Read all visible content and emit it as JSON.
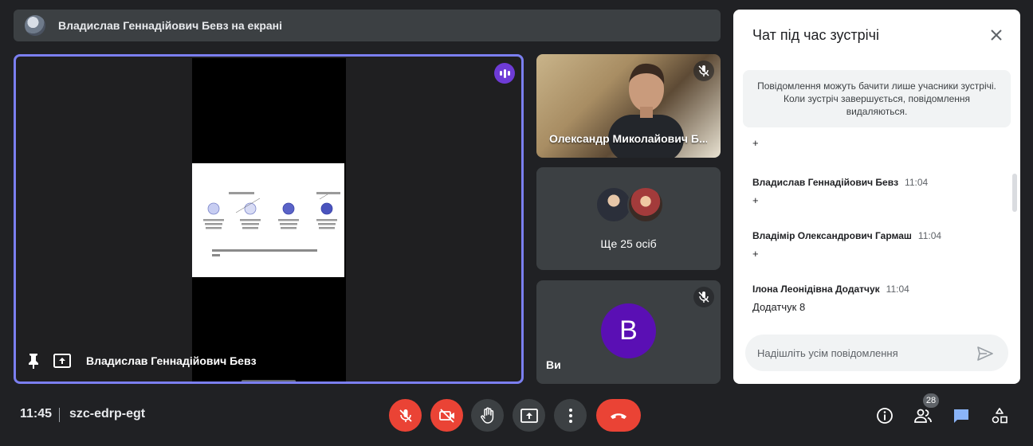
{
  "banner": {
    "text": "Владислав Геннадійович Бевз на екрані"
  },
  "main_tile": {
    "name": "Владислав Геннадійович Бевз"
  },
  "tiles": {
    "participant_a": "Олександр Миколайович Б...",
    "others_count_label": "Ще 25 осіб",
    "self_initial": "В",
    "self_label": "Ви"
  },
  "chat": {
    "title": "Чат під час зустрічі",
    "notice": "Повідомлення можуть бачити лише учасники зустрічі. Коли зустріч завершується, повідомлення видаляються.",
    "messages": [
      {
        "sender": "",
        "time": "",
        "text": "+"
      },
      {
        "sender": "Владислав Геннадійович Бевз",
        "time": "11:04",
        "text": "+"
      },
      {
        "sender": "Владімір Олександрович Гармаш",
        "time": "11:04",
        "text": "+"
      },
      {
        "sender": "Ілона Леонідівна Додатчук",
        "time": "11:04",
        "text": "Додатчук 8"
      }
    ],
    "input_placeholder": "Надішліть усім повідомлення"
  },
  "bottom_bar": {
    "time": "11:45",
    "meeting_code": "szc-edrp-egt",
    "people_count": "28"
  },
  "colors": {
    "background": "#202124",
    "danger": "#ea4335",
    "active_speaker_border": "#7b7ff0",
    "self_avatar": "#5a0fb4",
    "chat_active": "#8ab4f8"
  },
  "icons": [
    "pin-icon",
    "present-icon",
    "audio-activity-icon",
    "mic-off-icon",
    "close-icon",
    "send-icon",
    "video-off-icon",
    "raise-hand-icon",
    "more-options-icon",
    "hang-up-icon",
    "info-icon",
    "people-icon",
    "chat-icon",
    "activities-icon"
  ]
}
